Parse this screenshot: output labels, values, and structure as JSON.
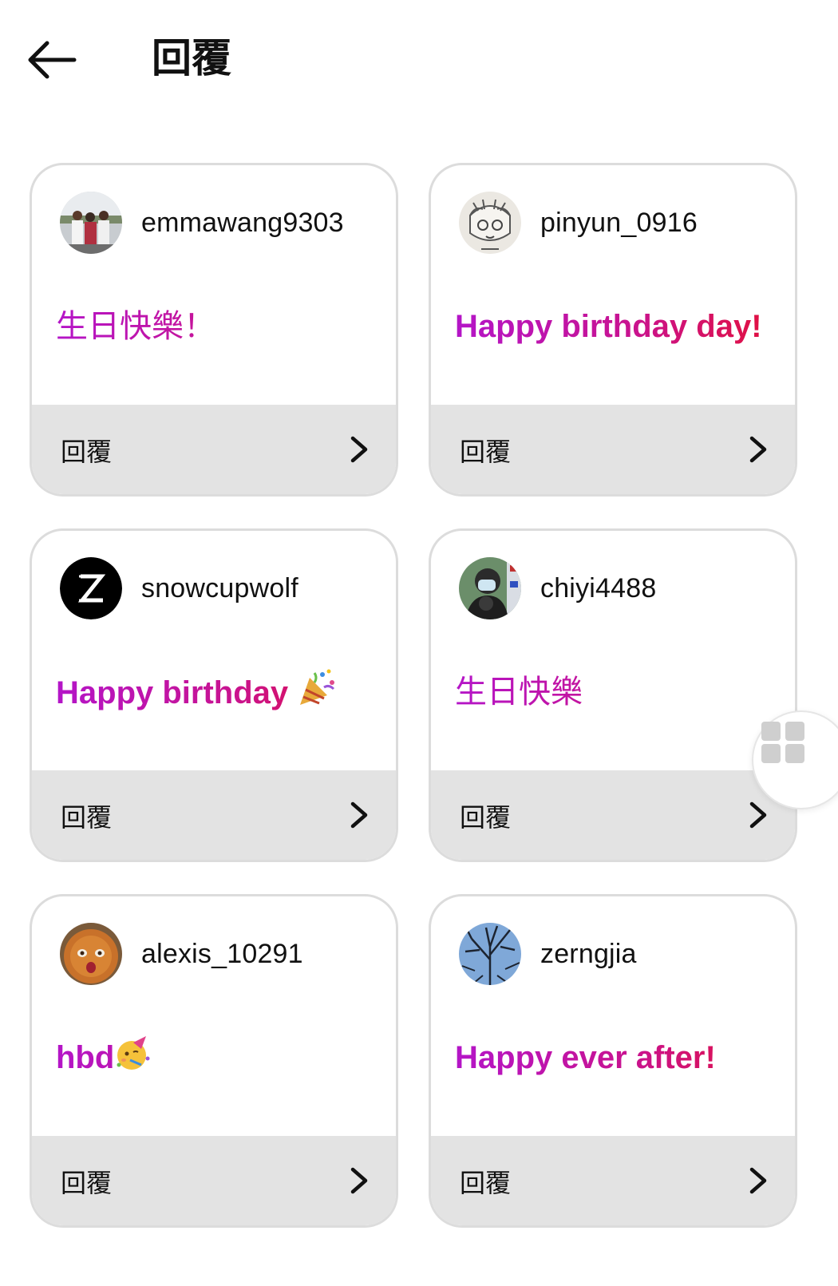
{
  "header": {
    "title": "回覆",
    "back_icon": "arrow-left-icon"
  },
  "cards": [
    {
      "username": "emmawang9303",
      "message": "生日快樂！",
      "emoji": "",
      "reply_label": "回覆"
    },
    {
      "username": "pinyun_0916",
      "message": "Happy birthday day!",
      "emoji": "",
      "reply_label": "回覆"
    },
    {
      "username": "snowcupwolf",
      "message": "Happy birthday ",
      "emoji": "🎉",
      "reply_label": "回覆"
    },
    {
      "username": "chiyi4488",
      "message": "生日快樂",
      "emoji": "",
      "reply_label": "回覆"
    },
    {
      "username": "alexis_10291",
      "message": "hbd",
      "emoji": "🥳",
      "reply_label": "回覆"
    },
    {
      "username": "zerngjia",
      "message": "Happy ever after!",
      "emoji": "",
      "reply_label": "回覆"
    }
  ],
  "colors": {
    "gradient_start": "#b415c8",
    "gradient_mid": "#c9138f",
    "gradient_end": "#e3103a",
    "footer_bg": "#e3e3e3",
    "card_border": "#dcdcdc"
  },
  "floating_button": {
    "icon": "grid-icon"
  }
}
